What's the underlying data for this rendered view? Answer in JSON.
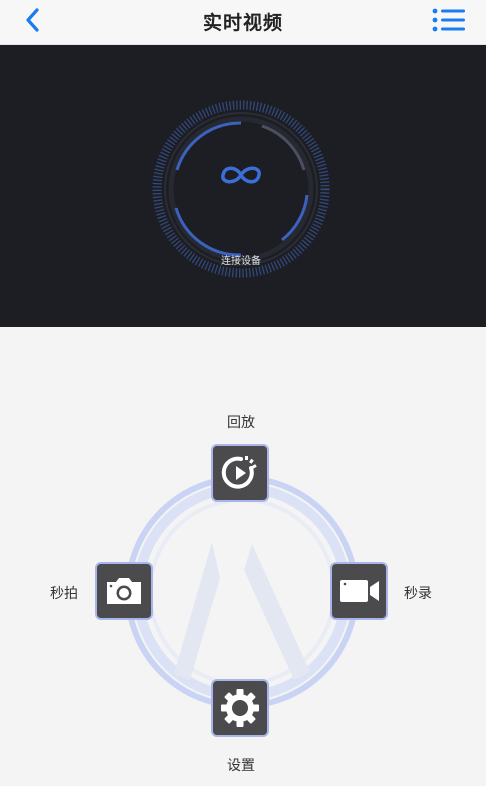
{
  "header": {
    "title": "实时视频",
    "back_icon": "chevron-left-icon",
    "menu_icon": "list-icon",
    "accent_color": "#1a7cf2"
  },
  "video": {
    "background_color": "#1c1e24",
    "connect_label": "连接设备",
    "connect_icon": "link-icon"
  },
  "controls": {
    "playback_label": "回放",
    "snapshot_label": "秒拍",
    "record_label": "秒录",
    "settings_label": "设置",
    "playback_icon": "playback-icon",
    "snapshot_icon": "camera-icon",
    "record_icon": "video-camera-icon",
    "settings_icon": "gear-icon"
  }
}
